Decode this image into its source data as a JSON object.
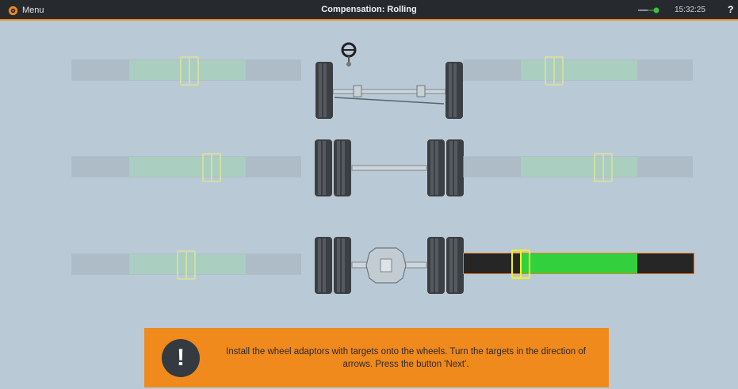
{
  "topbar": {
    "menu_label": "Menu",
    "title": "Compensation: Rolling",
    "time": "15:32:25",
    "help_label": "?"
  },
  "colors": {
    "background": "#b9cad6",
    "topbar": "#262a2e",
    "accent": "#f08a1c",
    "gauge_green_active": "#33d03d",
    "gauge_dark_active": "#262626",
    "gauge_green_inactive": "#9fd3ae",
    "gauge_gray_inactive": "#a4b1bb",
    "marker_yellow": "#f3f21a"
  },
  "axles": [
    {
      "name": "front-steer-axle",
      "type": "steer",
      "left_gauge_state": "inactive",
      "right_gauge_state": "inactive"
    },
    {
      "name": "middle-dual-axle",
      "type": "dual",
      "left_gauge_state": "inactive",
      "right_gauge_state": "inactive"
    },
    {
      "name": "rear-drive-axle",
      "type": "drive",
      "left_gauge_state": "inactive",
      "right_gauge_state": "active"
    }
  ],
  "message": {
    "icon": "exclamation-icon",
    "text": "Install the wheel adaptors with targets onto the wheels. Turn the targets in the direction of arrows. Press the button 'Next'."
  }
}
